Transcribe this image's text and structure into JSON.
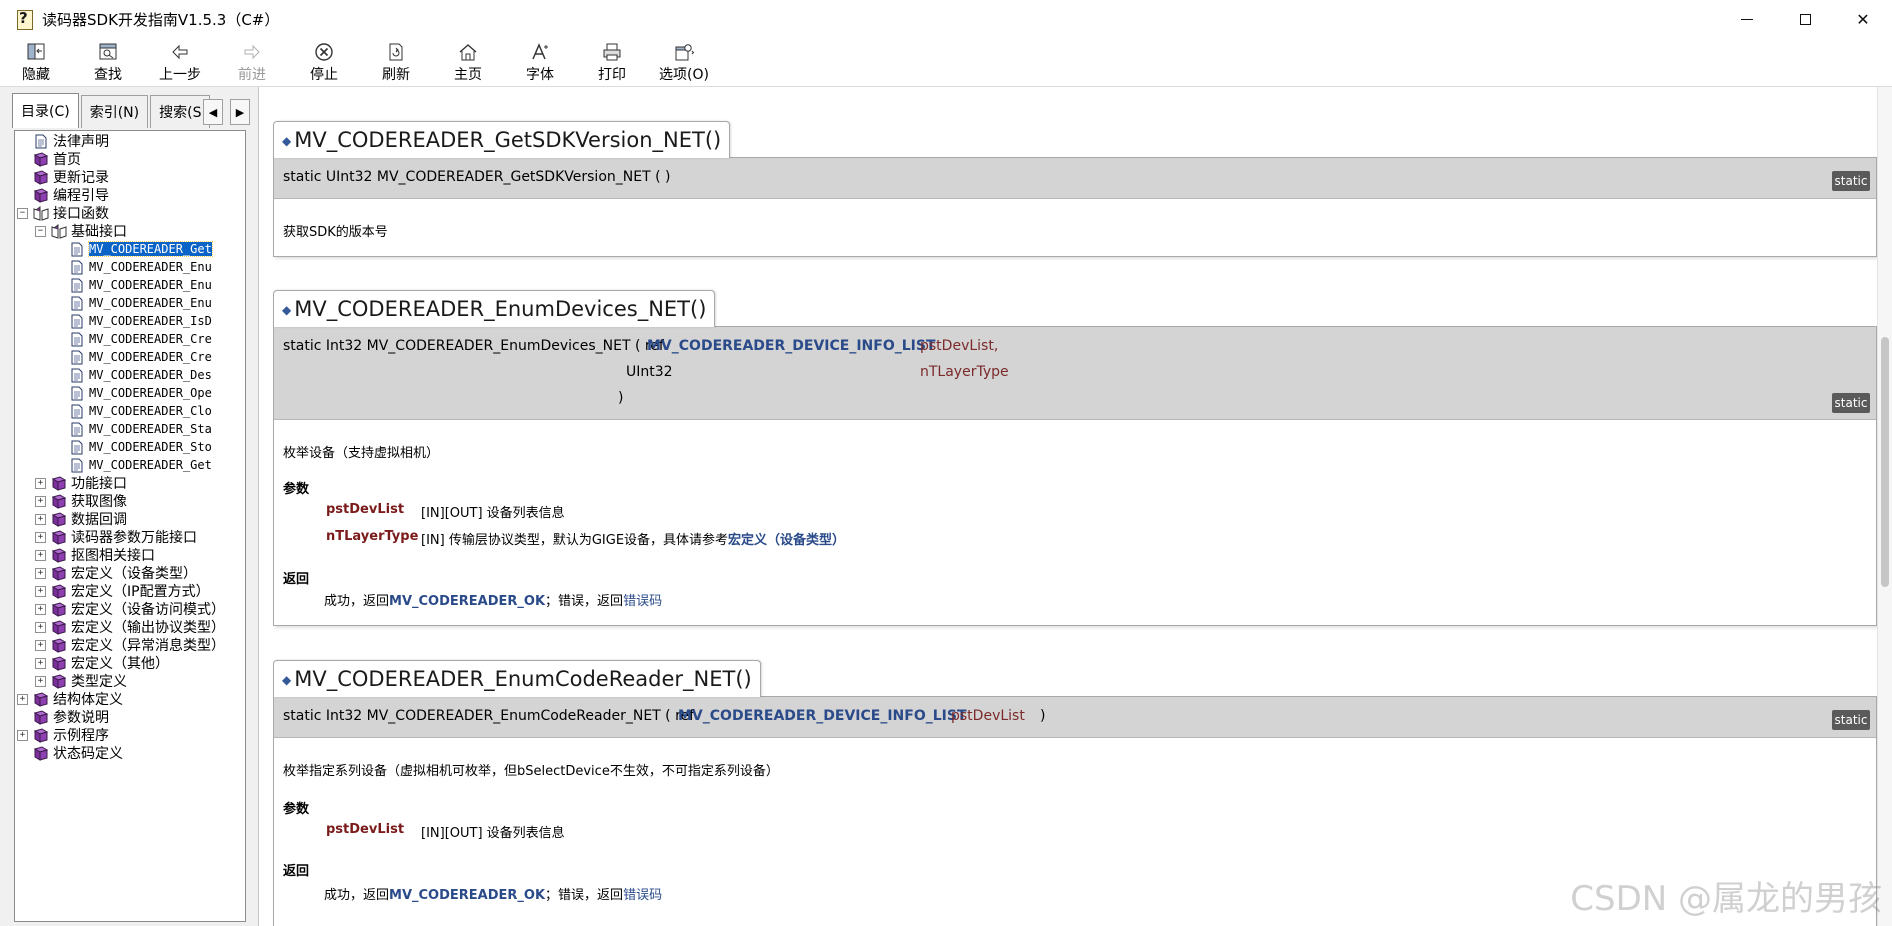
{
  "window": {
    "title": "读码器SDK开发指南V1.5.3（C#）",
    "close_glyph": "✕"
  },
  "toolbar": {
    "buttons": [
      {
        "label": "隐藏",
        "icon": "hide-pane-icon",
        "enabled": true
      },
      {
        "label": "查找",
        "icon": "find-icon",
        "enabled": true
      },
      {
        "label": "上一步",
        "icon": "back-arrow-icon",
        "enabled": true
      },
      {
        "label": "前进",
        "icon": "forward-arrow-icon",
        "enabled": false
      },
      {
        "label": "停止",
        "icon": "stop-icon",
        "enabled": true
      },
      {
        "label": "刷新",
        "icon": "refresh-icon",
        "enabled": true
      },
      {
        "label": "主页",
        "icon": "home-icon",
        "enabled": true
      },
      {
        "label": "字体",
        "icon": "font-icon",
        "enabled": true
      },
      {
        "label": "打印",
        "icon": "print-icon",
        "enabled": true
      },
      {
        "label": "选项(O)",
        "icon": "options-icon",
        "enabled": true
      }
    ]
  },
  "nav_tabs": {
    "contents": "目录(C)",
    "index": "索引(N)",
    "search": "搜索(S"
  },
  "tree": {
    "items": [
      {
        "label": "法律声明",
        "type": "page"
      },
      {
        "label": "首页",
        "type": "book"
      },
      {
        "label": "更新记录",
        "type": "book"
      },
      {
        "label": "编程引导",
        "type": "book"
      },
      {
        "label": "接口函数",
        "type": "book-open",
        "expander": "⊟"
      },
      {
        "label": "基础接口",
        "type": "book-open",
        "expander": "⊟"
      },
      {
        "label": "MV_CODEREADER_Get",
        "type": "page",
        "selected": true
      },
      {
        "label": "MV_CODEREADER_Enu",
        "type": "page"
      },
      {
        "label": "MV_CODEREADER_Enu",
        "type": "page"
      },
      {
        "label": "MV_CODEREADER_Enu",
        "type": "page"
      },
      {
        "label": "MV_CODEREADER_IsD",
        "type": "page"
      },
      {
        "label": "MV_CODEREADER_Cre",
        "type": "page"
      },
      {
        "label": "MV_CODEREADER_Cre",
        "type": "page"
      },
      {
        "label": "MV_CODEREADER_Des",
        "type": "page"
      },
      {
        "label": "MV_CODEREADER_Ope",
        "type": "page"
      },
      {
        "label": "MV_CODEREADER_Clo",
        "type": "page"
      },
      {
        "label": "MV_CODEREADER_Sta",
        "type": "page"
      },
      {
        "label": "MV_CODEREADER_Sto",
        "type": "page"
      },
      {
        "label": "MV_CODEREADER_Get",
        "type": "page"
      },
      {
        "label": "功能接口",
        "type": "book",
        "expander": "⊞"
      },
      {
        "label": "获取图像",
        "type": "book",
        "expander": "⊞"
      },
      {
        "label": "数据回调",
        "type": "book",
        "expander": "⊞"
      },
      {
        "label": "读码器参数万能接口",
        "type": "book",
        "expander": "⊞"
      },
      {
        "label": "抠图相关接口",
        "type": "book",
        "expander": "⊞"
      },
      {
        "label": "宏定义（设备类型）",
        "type": "book",
        "expander": "⊞"
      },
      {
        "label": "宏定义（IP配置方式）",
        "type": "book",
        "expander": "⊞"
      },
      {
        "label": "宏定义（设备访问模式）",
        "type": "book",
        "expander": "⊞"
      },
      {
        "label": "宏定义（输出协议类型）",
        "type": "book",
        "expander": "⊞"
      },
      {
        "label": "宏定义（异常消息类型）",
        "type": "book",
        "expander": "⊞"
      },
      {
        "label": "宏定义（其他）",
        "type": "book",
        "expander": "⊞"
      },
      {
        "label": "类型定义",
        "type": "book",
        "expander": "⊞"
      },
      {
        "label": "结构体定义",
        "type": "book",
        "expander": "⊞"
      },
      {
        "label": "参数说明",
        "type": "book"
      },
      {
        "label": "示例程序",
        "type": "book",
        "expander": "⊞"
      },
      {
        "label": "状态码定义",
        "type": "book"
      }
    ]
  },
  "members": {
    "m1": {
      "name": "MV_CODEREADER_GetSDKVersion_NET()",
      "proto": "static UInt32 MV_CODEREADER_GetSDKVersion_NET (  )",
      "badge": "static",
      "desc": "获取SDK的版本号"
    },
    "m2": {
      "name": "MV_CODEREADER_EnumDevices_NET()",
      "proto_prefix": "static Int32 MV_CODEREADER_EnumDevices_NET ( ref",
      "type1": "MV_CODEREADER_DEVICE_INFO_LIST",
      "param1": "pstDevList,",
      "type2": "UInt32",
      "param2": "nTLayerType",
      "close": ")",
      "badge": "static",
      "desc": "枚举设备（支持虚拟相机）",
      "params_title": "参数",
      "p1_name": "pstDevList",
      "p1_desc": "[IN][OUT] 设备列表信息",
      "p2_name": "nTLayerType",
      "p2_desc": "[IN] 传输层协议类型，默认为GIGE设备，具体请参考",
      "p2_link": "宏定义（设备类型）",
      "return_title": "返回",
      "ret_a": "成功，返回",
      "ret_ok": "MV_CODEREADER_OK",
      "ret_b": "；错误，返回",
      "ret_err": "错误码"
    },
    "m3": {
      "name": "MV_CODEREADER_EnumCodeReader_NET()",
      "proto_prefix": "static Int32 MV_CODEREADER_EnumCodeReader_NET ( ref",
      "type1": "MV_CODEREADER_DEVICE_INFO_LIST",
      "param1": "pstDevList",
      "close": ")",
      "badge": "static",
      "desc": "枚举指定系列设备（虚拟相机可枚举，但bSelectDevice不生效，不可指定系列设备）",
      "params_title": "参数",
      "p1_name": "pstDevList",
      "p1_desc": "[IN][OUT] 设备列表信息",
      "return_title": "返回",
      "ret_a": "成功，返回",
      "ret_ok": "MV_CODEREADER_OK",
      "ret_b": "；错误，返回",
      "ret_err": "错误码"
    }
  },
  "watermark": "CSDN @属龙的男孩"
}
